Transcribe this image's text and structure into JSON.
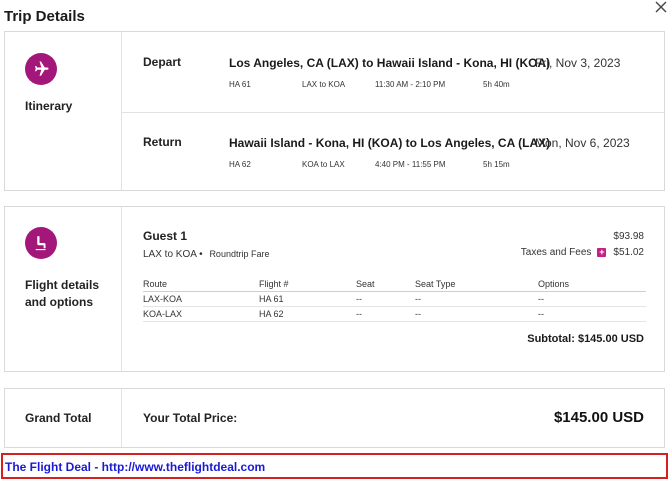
{
  "header": {
    "title": "Trip Details"
  },
  "itinerary": {
    "label": "Itinerary",
    "segments": [
      {
        "type": "Depart",
        "route": "Los Angeles, CA (LAX) to Hawaii Island - Kona, HI (KOA)",
        "date": "Fri, Nov 3, 2023",
        "flight": "HA 61",
        "leg": "LAX to KOA",
        "time": "11:30 AM - 2:10 PM",
        "duration": "5h 40m"
      },
      {
        "type": "Return",
        "route": "Hawaii Island - Kona, HI (KOA) to Los Angeles, CA (LAX)",
        "date": "Mon, Nov 6, 2023",
        "flight": "HA 62",
        "leg": "KOA to LAX",
        "time": "4:40 PM - 11:55 PM",
        "duration": "5h 15m"
      }
    ]
  },
  "details": {
    "label_line1": "Flight details",
    "label_line2": "and options",
    "guest": "Guest 1",
    "guest_price": "$93.98",
    "route": "LAX to KOA",
    "fare": "Roundtrip Fare",
    "taxes_label": "Taxes and Fees",
    "taxes_amount": "$51.02",
    "columns": [
      "Route",
      "Flight #",
      "Seat",
      "Seat Type",
      "Options"
    ],
    "rows": [
      [
        "LAX-KOA",
        "HA 61",
        "--",
        "--",
        "--"
      ],
      [
        "KOA-LAX",
        "HA 62",
        "--",
        "--",
        "--"
      ]
    ],
    "subtotal": "Subtotal:  $145.00 USD"
  },
  "grand": {
    "label": "Grand Total",
    "your_total_label": "Your Total Price:",
    "amount": "$145.00 USD"
  },
  "banner": {
    "text": "The Flight Deal - http://www.theflightdeal.com"
  },
  "colors": {
    "accent": "#a3177a",
    "badge": "#c41f84",
    "banner_border": "#d42020",
    "banner_text": "#1a1ad6"
  }
}
